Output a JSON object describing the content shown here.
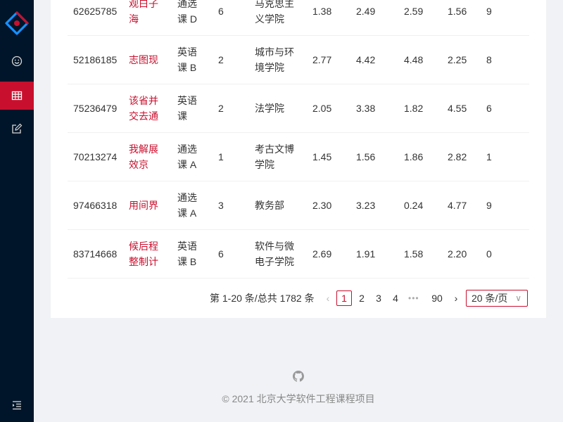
{
  "colors": {
    "accent": "#c8102e",
    "sider": "#001529"
  },
  "sidebar": {
    "items": [
      {
        "icon": "smile-icon"
      },
      {
        "icon": "table-icon",
        "active": true
      },
      {
        "icon": "form-edit-icon"
      }
    ],
    "collapse_icon": "menu-fold-icon"
  },
  "table": {
    "rows": [
      {
        "id": "62625785",
        "name": "观白子海",
        "type": "通选课 D",
        "credit": "6",
        "dept": "马克思主义学院",
        "a": "1.38",
        "b": "2.49",
        "c": "2.59",
        "d": "1.56",
        "e": "9"
      },
      {
        "id": "52186185",
        "name": "志图现",
        "type": "英语课 B",
        "credit": "2",
        "dept": "城市与环境学院",
        "a": "2.77",
        "b": "4.42",
        "c": "4.48",
        "d": "2.25",
        "e": "8"
      },
      {
        "id": "75236479",
        "name": "该省并交去通",
        "type": "英语课",
        "credit": "2",
        "dept": "法学院",
        "a": "2.05",
        "b": "3.38",
        "c": "1.82",
        "d": "4.55",
        "e": "6"
      },
      {
        "id": "70213274",
        "name": "我解展效京",
        "type": "通选课 A",
        "credit": "1",
        "dept": "考古文博学院",
        "a": "1.45",
        "b": "1.56",
        "c": "1.86",
        "d": "2.82",
        "e": "1"
      },
      {
        "id": "97466318",
        "name": "用间界",
        "type": "通选课 A",
        "credit": "3",
        "dept": "教务部",
        "a": "2.30",
        "b": "3.23",
        "c": "0.24",
        "d": "4.77",
        "e": "9"
      },
      {
        "id": "83714668",
        "name": "候后程整制计",
        "type": "英语课 B",
        "credit": "6",
        "dept": "软件与微电子学院",
        "a": "2.69",
        "b": "1.91",
        "c": "1.58",
        "d": "2.20",
        "e": "0"
      }
    ]
  },
  "pagination": {
    "total_text": "第 1-20 条/总共 1782 条",
    "prev": "‹",
    "next": "›",
    "pages": [
      "1",
      "2",
      "3",
      "4"
    ],
    "ellipsis": "•••",
    "last": "90",
    "current": "1",
    "page_size": "20 条/页",
    "page_size_arrow": "∨"
  },
  "footer": {
    "icon": "github-icon",
    "text": "© 2021 北京大学软件工程课程项目"
  }
}
